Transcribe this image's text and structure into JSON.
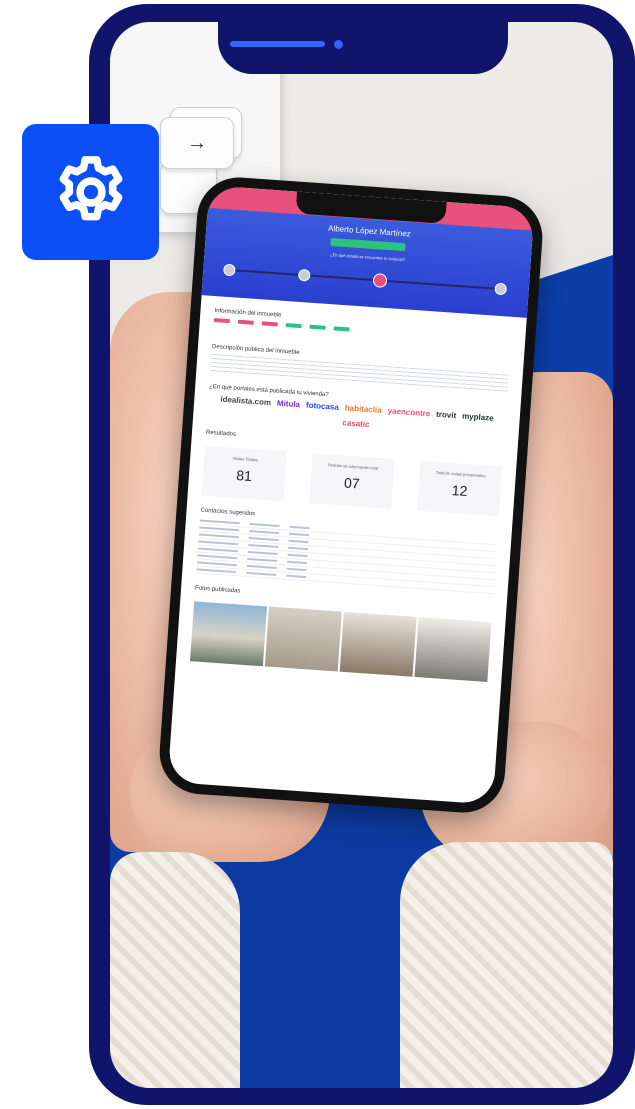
{
  "overlay": {
    "gear_icon": "gear-icon",
    "colors": {
      "frame": "#11146b",
      "badge": "#0d4ff7",
      "notch_accent": "#2f64ff"
    }
  },
  "keyboard": {
    "arrow_key": "→"
  },
  "inner_app": {
    "header": {
      "name": "Alberto López Martínez",
      "badge": "",
      "subtitle": "¿En qué estado se encuentra tu vivienda?"
    },
    "property_section_title": "Información del inmueble",
    "description_section_title": "Descripción pública del inmueble",
    "portals_section_title": "¿En qué portales está publicada tu vivienda?",
    "portals": [
      "idealista.com",
      "Mitula",
      "fotocasa",
      "habitaclia",
      "yaencontre",
      "trovit",
      "myplaze",
      "casatic"
    ],
    "stats_title": "Resultados",
    "stats": [
      {
        "label": "Visitas Totales",
        "value": "81"
      },
      {
        "label": "Petición de información total",
        "value": "07"
      },
      {
        "label": "Total de visitas presenciales",
        "value": "12"
      }
    ],
    "contacts_title": "Contactos sugeridos",
    "photos_title": "Fotos publicadas"
  }
}
